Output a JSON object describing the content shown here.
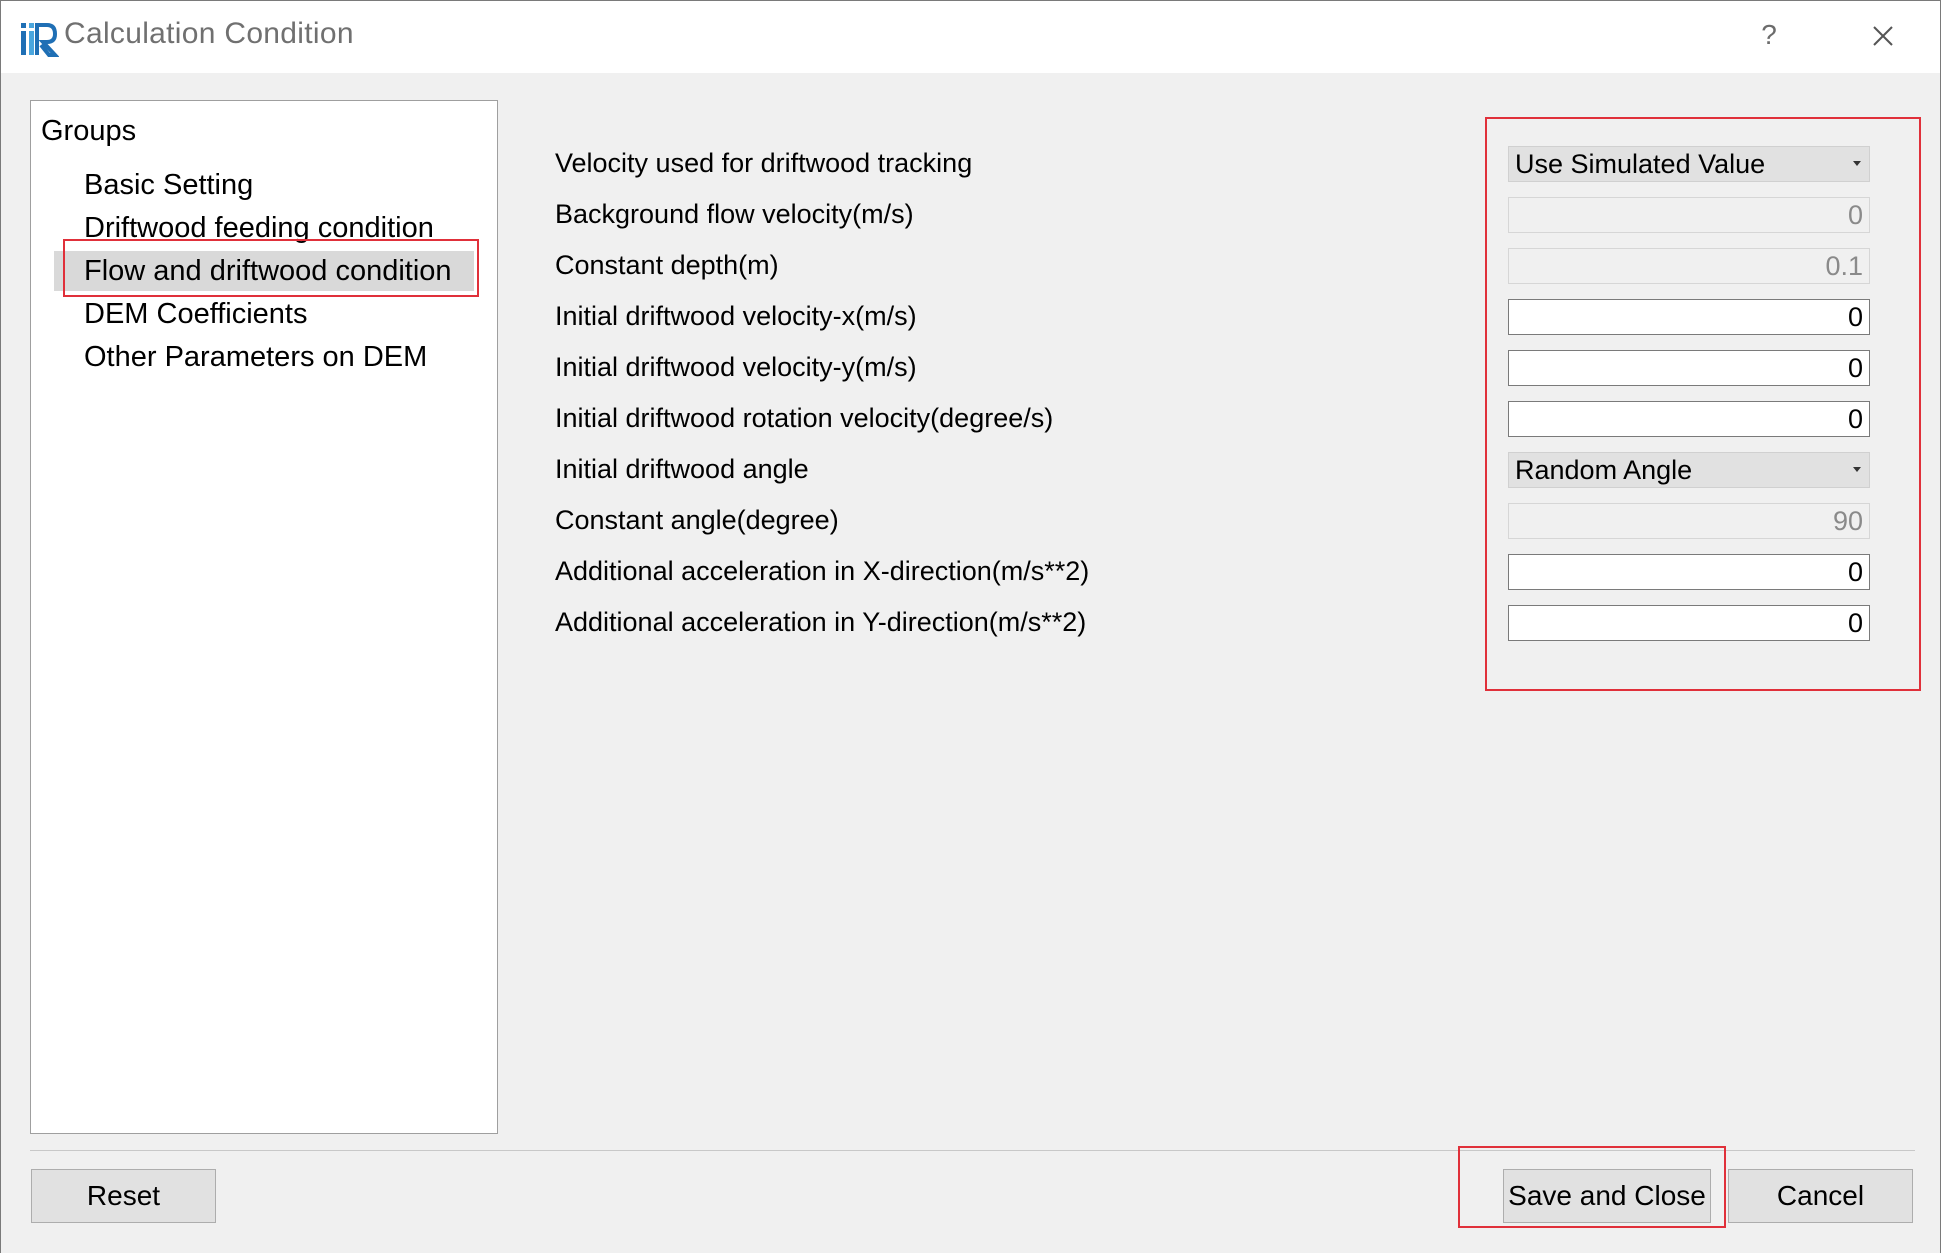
{
  "window": {
    "title": "Calculation Condition",
    "help_label": "?",
    "icons": {
      "app": "iric-logo-icon",
      "close": "close-icon"
    }
  },
  "groups": {
    "title": "Groups",
    "items": [
      {
        "label": "Basic Setting"
      },
      {
        "label": "Driftwood feeding condition"
      },
      {
        "label": "Flow and driftwood condition"
      },
      {
        "label": "DEM Coefficients"
      },
      {
        "label": "Other Parameters on DEM"
      }
    ],
    "selected": "Flow and driftwood condition"
  },
  "form": {
    "rows": [
      {
        "label": "Velocity used for driftwood tracking",
        "kind": "combo",
        "value": "Use Simulated Value"
      },
      {
        "label": "Background flow velocity(m/s)",
        "kind": "disabled",
        "value": "0"
      },
      {
        "label": "Constant depth(m)",
        "kind": "disabled",
        "value": "0.1"
      },
      {
        "label": "Initial driftwood velocity-x(m/s)",
        "kind": "enabled",
        "value": "0"
      },
      {
        "label": "Initial driftwood velocity-y(m/s)",
        "kind": "enabled",
        "value": "0"
      },
      {
        "label": "Initial driftwood rotation velocity(degree/s)",
        "kind": "enabled",
        "value": "0"
      },
      {
        "label": "Initial driftwood angle",
        "kind": "combo",
        "value": "Random Angle"
      },
      {
        "label": "Constant angle(degree)",
        "kind": "disabled",
        "value": "90"
      },
      {
        "label": "Additional acceleration in X-direction(m/s**2)",
        "kind": "enabled",
        "value": "0"
      },
      {
        "label": "Additional acceleration in Y-direction(m/s**2)",
        "kind": "enabled",
        "value": "0"
      }
    ]
  },
  "buttons": {
    "reset": "Reset",
    "save_close": "Save and Close",
    "cancel": "Cancel"
  },
  "colors": {
    "highlight": "#e0303a",
    "dialog_bg": "#f0f0f0",
    "selected_item": "#d9d9d9"
  }
}
